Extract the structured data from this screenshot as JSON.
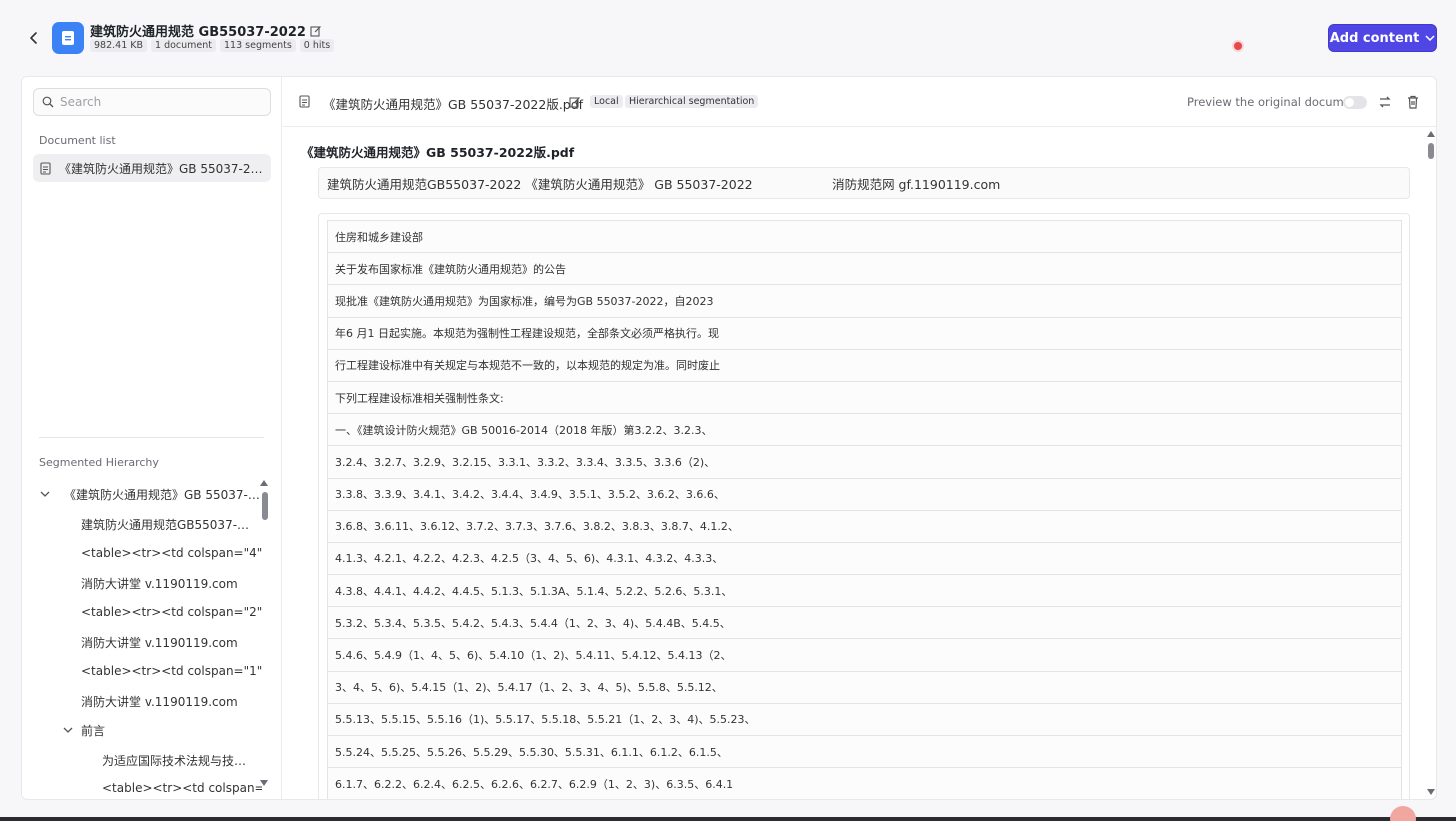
{
  "header": {
    "title": "建筑防火通用规范 GB55037-2022",
    "meta": [
      "982.41 KB",
      "1 document",
      "113 segments",
      "0 hits"
    ],
    "add_content_label": "Add content"
  },
  "sidebar": {
    "search_placeholder": "Search",
    "document_list_label": "Document list",
    "document_item": "《建筑防火通用规范》GB 55037-2…",
    "hierarchy_label": "Segmented Hierarchy",
    "tree": [
      {
        "label": "《建筑防火通用规范》GB 55037-…",
        "level": 0,
        "chevron": true
      },
      {
        "label": "建筑防火通用规范GB55037-…",
        "level": 1,
        "chevron": false
      },
      {
        "label": "<table><tr><td colspan=\"4\"…",
        "level": 1,
        "chevron": false
      },
      {
        "label": "消防大讲堂 v.1190119.com",
        "level": 1,
        "chevron": false
      },
      {
        "label": "<table><tr><td colspan=\"2\"…",
        "level": 1,
        "chevron": false
      },
      {
        "label": "消防大讲堂 v.1190119.com",
        "level": 1,
        "chevron": false
      },
      {
        "label": "<table><tr><td colspan=\"1\"…",
        "level": 1,
        "chevron": false
      },
      {
        "label": "消防大讲堂 v.1190119.com",
        "level": 1,
        "chevron": false
      },
      {
        "label": "前言",
        "level": 1,
        "chevron": true
      },
      {
        "label": "为适应国际技术法规与技…",
        "level": 2,
        "chevron": false
      },
      {
        "label": "<table><tr><td colspan=…",
        "level": 2,
        "chevron": false
      }
    ]
  },
  "content": {
    "file_name": "《建筑防火通用规范》GB 55037-2022版.pdf",
    "tags": [
      "Local",
      "Hierarchical segmentation"
    ],
    "preview_label": "Preview the original document",
    "doc_title": "《建筑防火通用规范》GB 55037-2022版.pdf",
    "segment_text": "建筑防火通用规范GB55037-2022 《建筑防火通用规范》 GB 55037-2022                    消防规范网 gf.1190119.com",
    "table_rows": [
      "住房和城乡建设部",
      "关于发布国家标准《建筑防火通用规范》的公告",
      "现批准《建筑防火通用规范》为国家标准，编号为GB 55037-2022，自2023",
      "年6 月1 日起实施。本规范为强制性工程建设规范，全部条文必须严格执行。现",
      "行工程建设标准中有关规定与本规范不一致的，以本规范的规定为准。同时废止",
      "下列工程建设标准相关强制性条文:",
      "一、《建筑设计防火规范》GB 50016-2014（2018 年版）第3.2.2、3.2.3、",
      "3.2.4、3.2.7、3.2.9、3.2.15、3.3.1、3.3.2、3.3.4、3.3.5、3.3.6（2)、",
      "3.3.8、3.3.9、3.4.1、3.4.2、3.4.4、3.4.9、3.5.1、3.5.2、3.6.2、3.6.6、",
      "3.6.8、3.6.11、3.6.12、3.7.2、3.7.3、3.7.6、3.8.2、3.8.3、3.8.7、4.1.2、",
      "4.1.3、4.2.1、4.2.2、4.2.3、4.2.5（3、4、5、6)、4.3.1、4.3.2、4.3.3、",
      "4.3.8、4.4.1、4.4.2、4.4.5、5.1.3、5.1.3A、5.1.4、5.2.2、5.2.6、5.3.1、",
      "5.3.2、5.3.4、5.3.5、5.4.2、5.4.3、5.4.4（1、2、3、4)、5.4.4B、5.4.5、",
      "5.4.6、5.4.9（1、4、5、6)、5.4.10（1、2)、5.4.11、5.4.12、5.4.13（2、",
      "3、4、5、6)、5.4.15（1、2)、5.4.17（1、2、3、4、5)、5.5.8、5.5.12、",
      "5.5.13、5.5.15、5.5.16（1)、5.5.17、5.5.18、5.5.21（1、2、3、4)、5.5.23、",
      "5.5.24、5.5.25、5.5.26、5.5.29、5.5.30、5.5.31、6.1.1、6.1.2、6.1.5、",
      "6.1.7、6.2.2、6.2.4、6.2.5、6.2.6、6.2.7、6.2.9（1、2、3)、6.3.5、6.4.1"
    ]
  },
  "colors": {
    "accent": "#4f46e5",
    "doc_icon": "#3b82f6",
    "notification": "#e5484d"
  }
}
